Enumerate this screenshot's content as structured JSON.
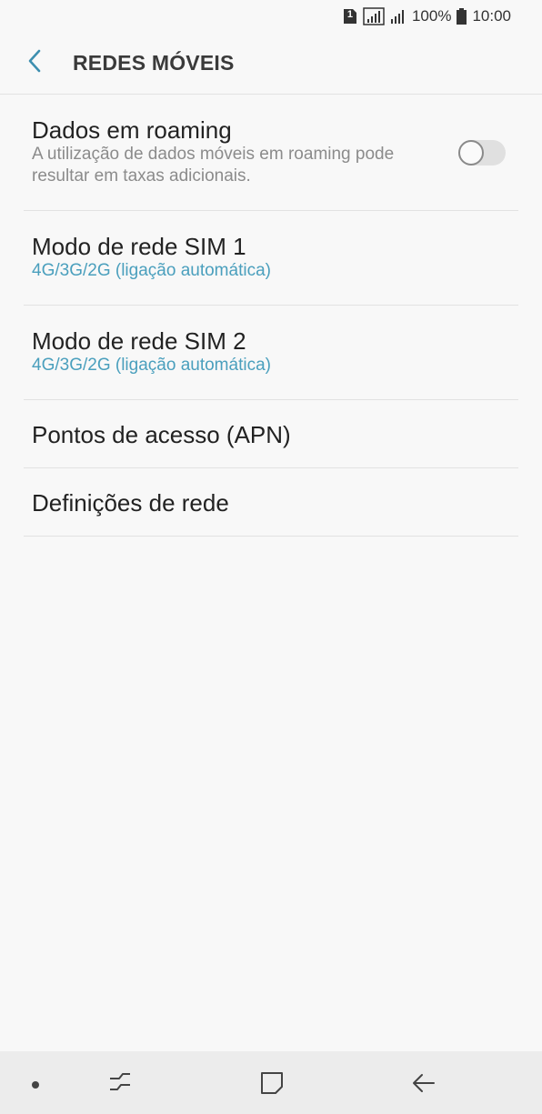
{
  "status_bar": {
    "sim_badge": "1",
    "battery": "100%",
    "time": "10:00"
  },
  "header": {
    "title": "REDES MÓVEIS"
  },
  "settings": {
    "roaming": {
      "title": "Dados em roaming",
      "description": "A utilização de dados móveis em roaming pode resultar em taxas adicionais.",
      "enabled": false
    },
    "sim1": {
      "title": "Modo de rede SIM 1",
      "value": "4G/3G/2G (ligação automática)"
    },
    "sim2": {
      "title": "Modo de rede SIM 2",
      "value": "4G/3G/2G (ligação automática)"
    },
    "apn": {
      "title": "Pontos de acesso (APN)"
    },
    "network": {
      "title": "Definições de rede"
    }
  },
  "colors": {
    "accent": "#4a9fbd",
    "background": "#f8f8f8",
    "nav_bar": "#ececec"
  }
}
